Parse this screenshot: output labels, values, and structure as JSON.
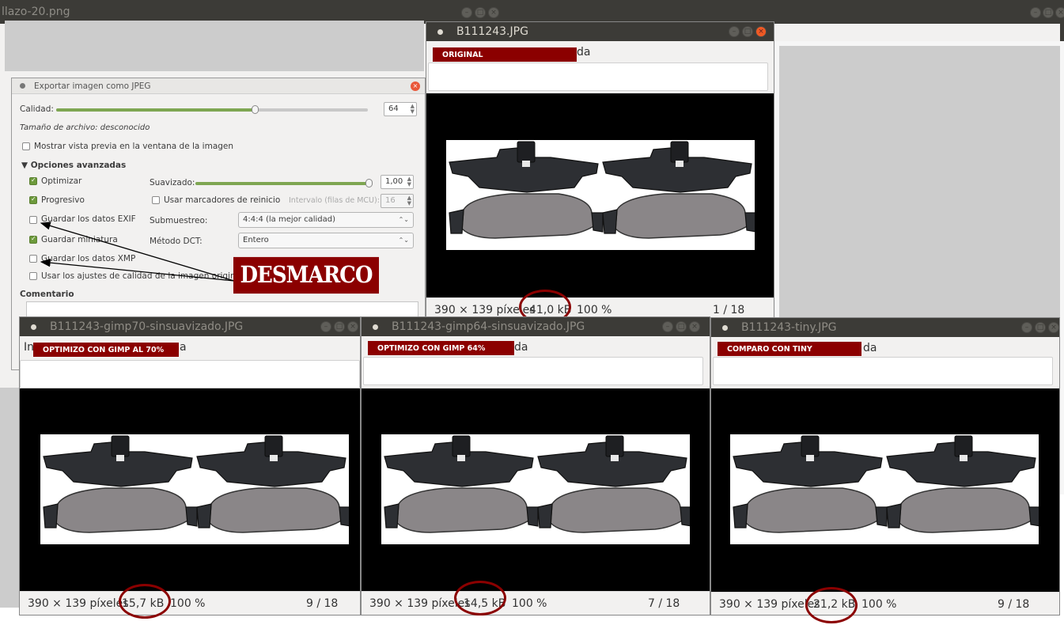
{
  "background_window": {
    "title": "llazo-20.png"
  },
  "export_dialog": {
    "title": "Exportar imagen como JPEG",
    "quality_label": "Calidad:",
    "quality_value": "64",
    "quality_fraction": 0.64,
    "file_size_text": "Tamaño de archivo: desconocido",
    "preview_checkbox": {
      "label": "Mostrar vista previa en la ventana de la imagen",
      "checked": false
    },
    "advanced_header": "▼ Opciones avanzadas",
    "optimize": {
      "label": "Optimizar",
      "checked": true
    },
    "progressive": {
      "label": "Progresivo",
      "checked": true
    },
    "save_exif": {
      "label": "Guardar los datos EXIF",
      "checked": false
    },
    "save_thumbnail": {
      "label": "Guardar miniatura",
      "checked": true
    },
    "save_xmp": {
      "label": "Guardar los datos XMP",
      "checked": false
    },
    "use_quality": {
      "label": "Usar los ajustes de calidad de la imagen original",
      "checked": false
    },
    "smoothing_label": "Suavizado:",
    "smoothing_value": "1,00",
    "smoothing_fraction": 1.0,
    "restart_markers": {
      "label": "Usar marcadores de reinicio",
      "checked": false
    },
    "interval_label": "Intervalo (filas de MCU):",
    "interval_value": "16",
    "subsampling_label": "Submuestreo:",
    "subsampling_value": "4:4:4 (la mejor calidad)",
    "dct_label": "Método DCT:",
    "dct_value": "Entero",
    "comment_label": "Comentario"
  },
  "annotation": {
    "desmarco": "DESMARCO",
    "color": "#8b0000"
  },
  "viewers": [
    {
      "title": "B111243.JPG",
      "label": "ORIGINAL",
      "ghost_text": "da",
      "dims": "390 × 139 píxeles",
      "size": "41,0 kB",
      "zoom": "100 %",
      "index": "1 / 18"
    },
    {
      "title": "B111243-gimp70-sinsuavizado.JPG",
      "label": "OPTIMIZO CON GIMP AL 70%",
      "ghost_prefix": "In",
      "ghost_text": "a",
      "dims": "390 × 139 píxeles",
      "size": "15,7 kB",
      "zoom": "100 %",
      "index": "9 / 18"
    },
    {
      "title": "B111243-gimp64-sinsuavizado.JPG",
      "label": "OPTIMIZO CON GIMP 64%",
      "ghost_text": "da",
      "dims": "390 × 139 píxeles",
      "size": "14,5 kB",
      "zoom": "100 %",
      "index": "7 / 18"
    },
    {
      "title": "B111243-tiny.JPG",
      "label": "COMPARO CON TINY",
      "ghost_text": "da",
      "dims": "390 × 139 píxeles",
      "size": "21,2 kB",
      "zoom": "100 %",
      "index": "9 / 18"
    }
  ],
  "icons": [
    "minimize-icon",
    "maximize-icon",
    "close-icon",
    "window-menu-icon",
    "chevron-down-icon",
    "arrow-icon"
  ]
}
